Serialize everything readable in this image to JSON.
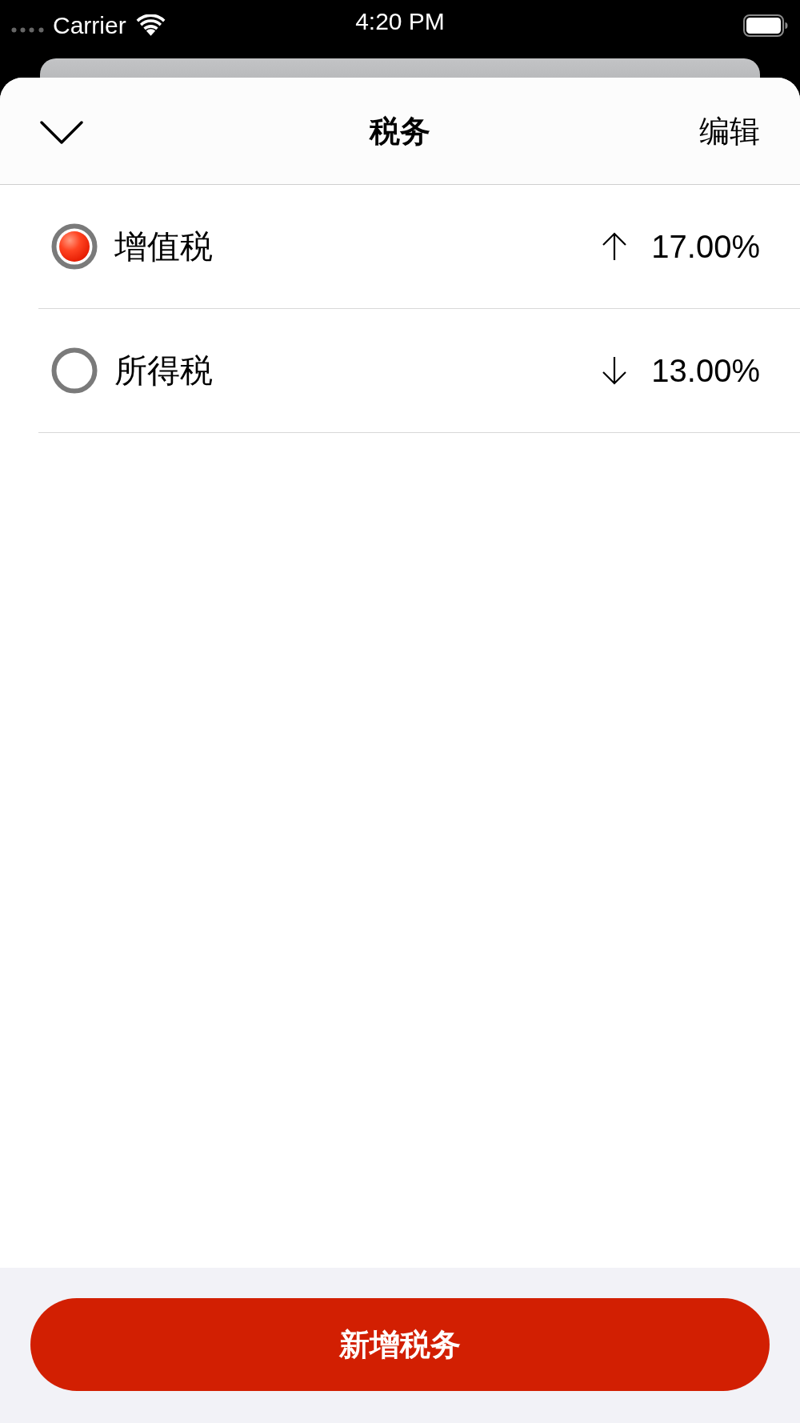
{
  "status_bar": {
    "carrier": "Carrier",
    "time": "4:20 PM"
  },
  "header": {
    "title": "税务",
    "edit": "编辑"
  },
  "taxes": [
    {
      "name": "增值税",
      "selected": true,
      "kind": "up",
      "rate": "17.00%"
    },
    {
      "name": "所得税",
      "selected": false,
      "kind": "down",
      "rate": "13.00%"
    }
  ],
  "add_button": {
    "label": "新增税务"
  }
}
